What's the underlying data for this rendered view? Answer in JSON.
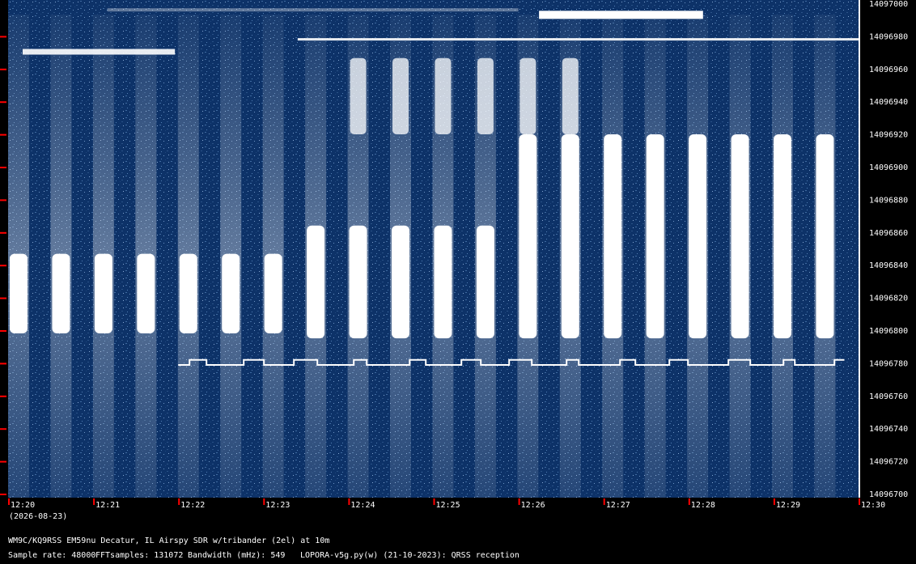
{
  "frequency_axis": {
    "unit": "Hz",
    "labels": [
      "14097000",
      "14096980",
      "14096960",
      "14096940",
      "14096920",
      "14096900",
      "14096880",
      "14096860",
      "14096840",
      "14096820",
      "14096800",
      "14096780",
      "14096760",
      "14096740",
      "14096720",
      "14096700"
    ],
    "tick_color": "#ff0000"
  },
  "time_axis": {
    "labels": [
      "12:20",
      "12:21",
      "12:22",
      "12:23",
      "12:24",
      "12:25",
      "12:26",
      "12:27",
      "12:28",
      "12:29",
      "12:30"
    ],
    "date": "(2026-08-23)",
    "tick_color": "#ff0000"
  },
  "footer": {
    "station": "WM9C/KQ9RSS EM59nu Decatur, IL  Airspy SDR w/tribander (2el) at 10m",
    "sample_rate": "Sample rate: 48000",
    "fft_samples": "FFTsamples: 131072",
    "bandwidth": "Bandwidth (mHz): 549",
    "software": "LOPORA-v5g.py(w) (21-10-2023): QRSS reception"
  },
  "colors": {
    "background": "#000000",
    "waterfall_base": "#0d3268",
    "signal": "#ffffff"
  },
  "chart_data": {
    "type": "heatmap",
    "description_text": "",
    "x": {
      "kind": "time",
      "range": [
        "12:20",
        "12:30"
      ]
    },
    "y": {
      "kind": "frequency_hz",
      "range": [
        14096700,
        14097000
      ]
    },
    "signals": [
      {
        "freq_hz": 14096825,
        "start": "12:20",
        "end": "12:30",
        "pattern": "periodic bars"
      },
      {
        "freq_hz": 14096781,
        "start": "12:22",
        "end": "12:29:50",
        "pattern": "FSK trace"
      },
      {
        "freq_hz": 14096970,
        "start": "12:20",
        "end": "12:22",
        "pattern": "trace"
      },
      {
        "freq_hz": 14096978,
        "start": "12:23:30",
        "end": "12:30",
        "pattern": "trace"
      },
      {
        "freq_hz": 14096993,
        "start": "12:26:10",
        "end": "12:28",
        "pattern": "trace"
      }
    ]
  }
}
